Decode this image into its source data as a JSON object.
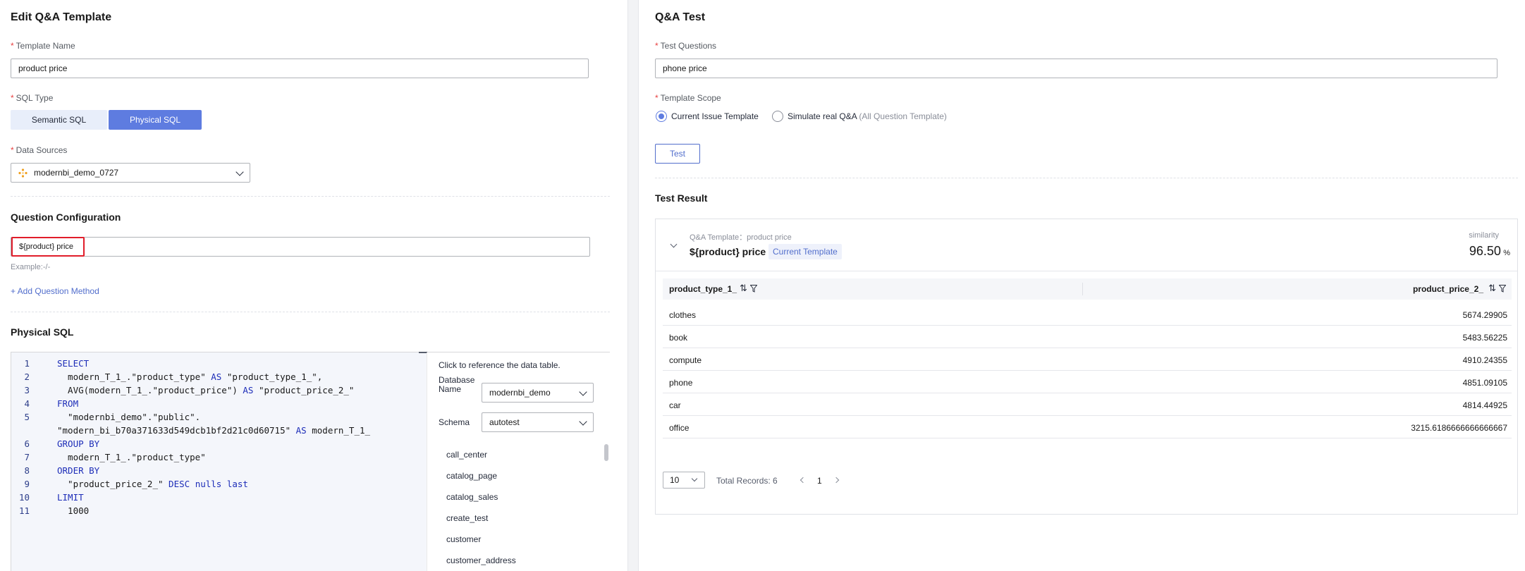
{
  "left": {
    "title": "Edit Q&A Template",
    "template_name": {
      "label": "Template Name",
      "value": "product price"
    },
    "sql_type": {
      "label": "SQL Type",
      "options": [
        "Semantic SQL",
        "Physical SQL"
      ],
      "selected": "Physical SQL"
    },
    "data_sources": {
      "label": "Data Sources",
      "value": "modernbi_demo_0727"
    },
    "question_config": {
      "title": "Question Configuration",
      "value": "${product} price",
      "example": "Example:-/-",
      "add_method": "+ Add Question Method"
    },
    "physical_sql": {
      "title": "Physical SQL",
      "lines": [
        {
          "num": "1",
          "kw": "SELECT",
          "text": ""
        },
        {
          "num": "2",
          "kw": "",
          "text": "  modern_T_1_.\"product_type\" AS \"product_type_1_\","
        },
        {
          "num": "3",
          "kw": "",
          "text": "  AVG(modern_T_1_.\"product_price\") AS \"product_price_2_\""
        },
        {
          "num": "4",
          "kw": "FROM",
          "text": ""
        },
        {
          "num": "5",
          "kw": "",
          "text": "  \"modernbi_demo\".\"public\"."
        },
        {
          "num": "",
          "kw": "",
          "text": "\"modern_bi_b70a371633d549dcb1bf2d21c0d60715\" AS modern_T_1_"
        },
        {
          "num": "6",
          "kw": "GROUP BY",
          "text": ""
        },
        {
          "num": "7",
          "kw": "",
          "text": "  modern_T_1_.\"product_type\""
        },
        {
          "num": "8",
          "kw": "ORDER BY",
          "text": ""
        },
        {
          "num": "9",
          "kw": "",
          "text": "  \"product_price_2_\" DESC nulls last"
        },
        {
          "num": "10",
          "kw": "LIMIT",
          "text": ""
        },
        {
          "num": "11",
          "kw": "",
          "text": "  1000"
        }
      ],
      "ref_panel": {
        "hint": "Click to reference the data table.",
        "db_label_1": "Database",
        "db_label_2": "Name",
        "db_value": "modernbi_demo",
        "schema_label": "Schema",
        "schema_value": "autotest",
        "tables": [
          "call_center",
          "catalog_page",
          "catalog_sales",
          "create_test",
          "customer",
          "customer_address"
        ]
      }
    }
  },
  "right": {
    "title": "Q&A Test",
    "test_questions": {
      "label": "Test Questions",
      "value": "phone price"
    },
    "template_scope": {
      "label": "Template Scope",
      "option1": "Current Issue Template",
      "option2": "Simulate real Q&A",
      "option2_hint": "(All Question Template)",
      "selected": "Current Issue Template"
    },
    "test_button": "Test",
    "result": {
      "title": "Test Result",
      "template_caption": "Q&A Template：product price",
      "question": "${product} price",
      "tag": "Current Template",
      "similarity_label": "similarity",
      "similarity_value": "96.50",
      "similarity_unit": "%",
      "columns": [
        "product_type_1_",
        "product_price_2_"
      ],
      "rows": [
        [
          "clothes",
          "5674.29905"
        ],
        [
          "book",
          "5483.56225"
        ],
        [
          "compute",
          "4910.24355"
        ],
        [
          "phone",
          "4851.09105"
        ],
        [
          "car",
          "4814.44925"
        ],
        [
          "office",
          "3215.6186666666666667"
        ]
      ],
      "page_size": "10",
      "total_records": "Total Records: 6",
      "current_page": "1"
    }
  },
  "colors": {
    "accent": "#5e7ce0",
    "link": "#526ecc",
    "required": "#e84141",
    "error_border": "#e11d2a"
  }
}
